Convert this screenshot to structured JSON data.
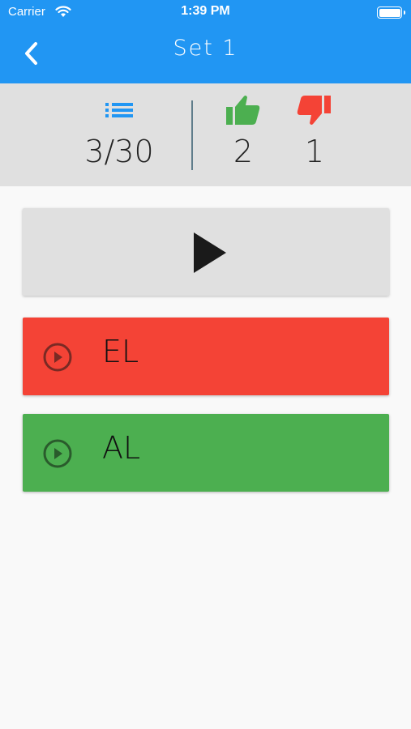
{
  "status_bar": {
    "carrier": "Carrier",
    "time": "1:39 PM"
  },
  "nav": {
    "title": "Set 1"
  },
  "stats": {
    "progress": "3/30",
    "correct": "2",
    "wrong": "1"
  },
  "answers": [
    {
      "label": "EL",
      "color": "#f44336"
    },
    {
      "label": "AL",
      "color": "#4caf50"
    }
  ],
  "colors": {
    "primary": "#2196f3",
    "correct": "#4caf50",
    "wrong": "#f44336"
  }
}
